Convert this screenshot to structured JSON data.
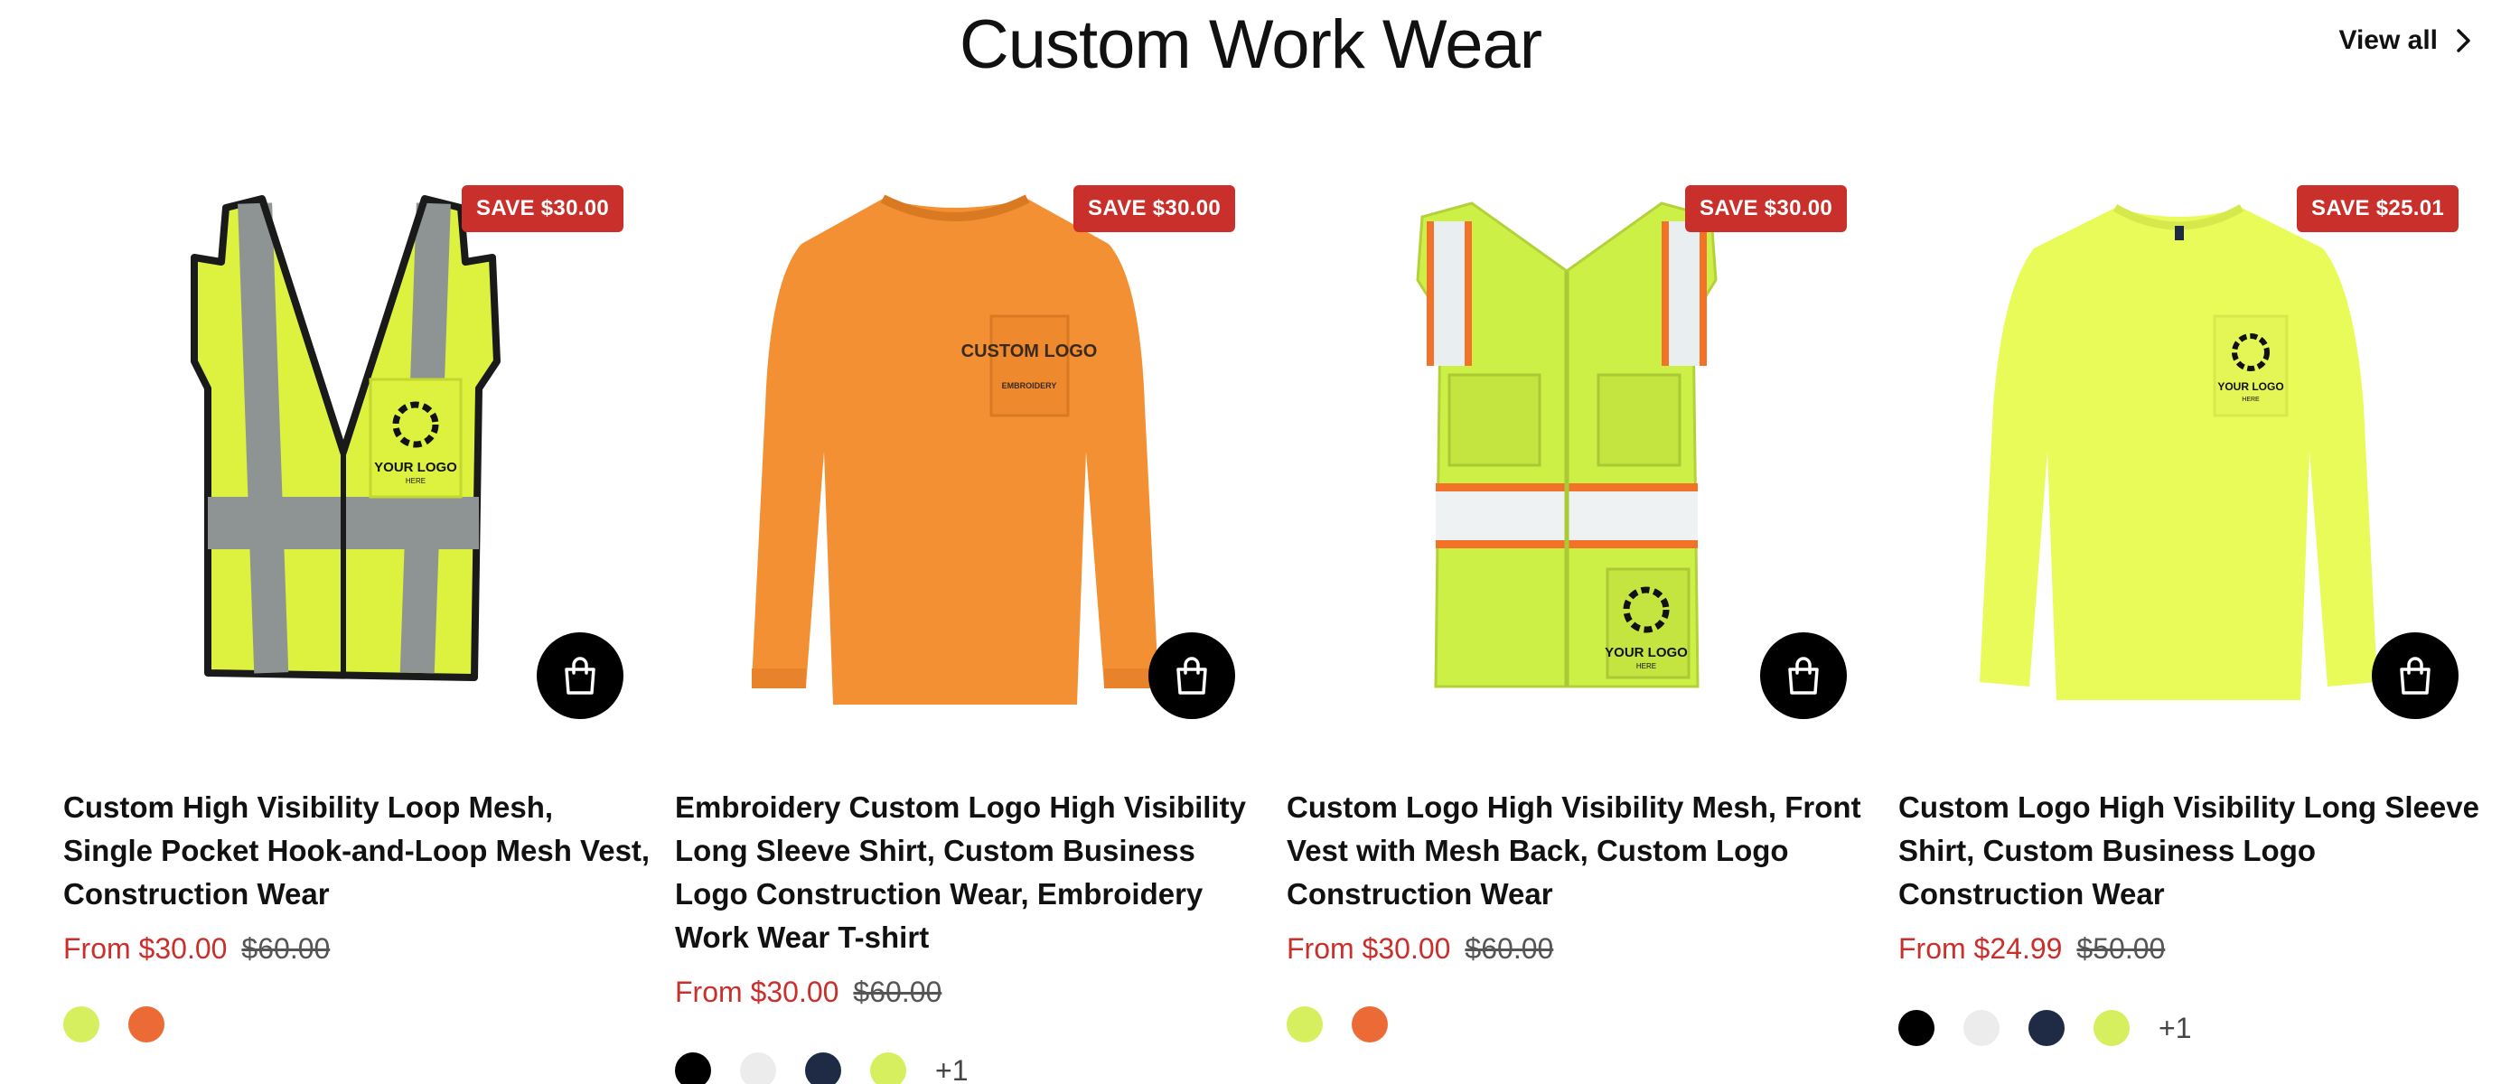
{
  "section": {
    "title": "Custom Work Wear",
    "view_all_label": "View all"
  },
  "products": [
    {
      "badge": "SAVE $30.00",
      "image": "yellow-mesh-safety-vest",
      "logo_text": "YOUR LOGO",
      "logo_sub": "HERE",
      "title": "Custom High Visibility Loop Mesh, Single Pocket Hook-and-Loop Mesh Vest, Construction Wear",
      "price": "From $30.00",
      "compare_price": "$60.00",
      "swatches": [
        "#d6ef5f",
        "#ec6a35"
      ],
      "more": ""
    },
    {
      "badge": "SAVE $30.00",
      "image": "orange-long-sleeve-shirt",
      "logo_text": "CUSTOM LOGO",
      "logo_sub": "EMBROIDERY",
      "title": "Embroidery Custom Logo High Visibility Long Sleeve Shirt, Custom Business Logo Construction Wear, Embroidery Work Wear T-shirt",
      "price": "From $30.00",
      "compare_price": "$60.00",
      "swatches": [
        "#000000",
        "#ececec",
        "#1f2a44",
        "#d6ef5f"
      ],
      "more": "+1"
    },
    {
      "badge": "SAVE $30.00",
      "image": "yellow-surveyor-vest-front",
      "logo_text": "YOUR LOGO",
      "logo_sub": "HERE",
      "title": "Custom Logo High Visibility Mesh, Front Vest with Mesh Back, Custom Logo Construction Wear",
      "price": "From $30.00",
      "compare_price": "$60.00",
      "swatches": [
        "#d6ef5f",
        "#ec6a35"
      ],
      "more": ""
    },
    {
      "badge": "SAVE $25.01",
      "image": "yellow-long-sleeve-shirt",
      "logo_text": "YOUR LOGO",
      "logo_sub": "HERE",
      "title": "Custom Logo High Visibility Long Sleeve Shirt, Custom Business Logo Construction Wear",
      "price": "From $24.99",
      "compare_price": "$50.00",
      "swatches": [
        "#000000",
        "#ececec",
        "#1f2a44",
        "#d6ef5f"
      ],
      "more": "+1"
    }
  ]
}
